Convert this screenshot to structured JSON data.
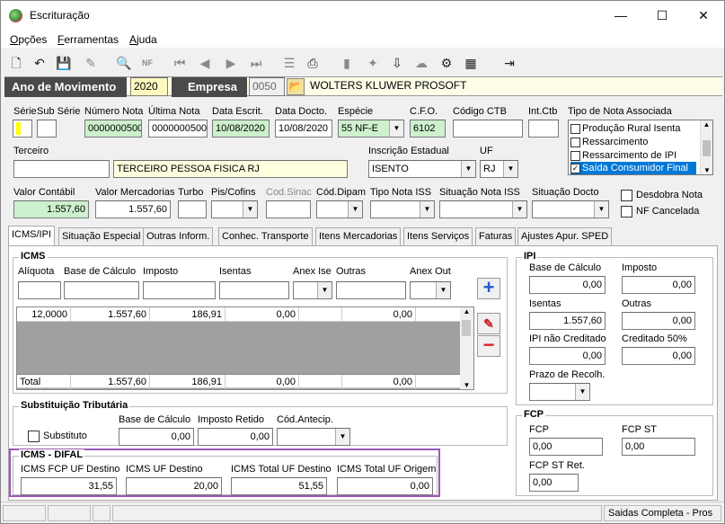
{
  "window": {
    "title": "Escrituração",
    "min": "—",
    "max": "☐",
    "close": "✕"
  },
  "menu": [
    {
      "u": "O",
      "rest": "pções"
    },
    {
      "u": "F",
      "rest": "erramentas"
    },
    {
      "u": "A",
      "rest": "juda"
    }
  ],
  "yearbar": {
    "ano_label": "Ano de Movimento",
    "ano": "2020",
    "empresa_label": "Empresa",
    "empresa_code": "0050",
    "empresa_name": "WOLTERS KLUWER PROSOFT"
  },
  "header": {
    "serie_label": "Série",
    "subserie_label": "Sub Série",
    "numero_nota_label": "Número Nota",
    "numero_nota": "0000000500",
    "ultima_nota_label": "Última Nota",
    "ultima_nota": "0000000500",
    "data_escrit_label": "Data Escrit.",
    "data_escrit": "10/08/2020",
    "data_docto_label": "Data Docto.",
    "data_docto": "10/08/2020",
    "especie_label": "Espécie",
    "especie": "55  NF-E",
    "cfo_label": "C.F.O.",
    "cfo": "6102",
    "codigo_ctb_label": "Código CTB",
    "int_ctb_label": "Int.Ctb",
    "tipo_nota_label": "Tipo de Nota Associada",
    "tipo_nota_items": [
      {
        "label": "Produção Rural Isenta",
        "checked": ""
      },
      {
        "label": "Ressarcimento",
        "checked": ""
      },
      {
        "label": "Ressarcimento de IPI",
        "checked": ""
      },
      {
        "label": "Saída Consumidor Final",
        "checked": "✓"
      }
    ],
    "terceiro_label": "Terceiro",
    "terceiro_name": "TERCEIRO PESSOA FISICA RJ",
    "inscricao_label": "Inscrição Estadual",
    "inscricao": "ISENTO",
    "uf_label": "UF",
    "uf": "RJ",
    "valor_contabil_label": "Valor Contábil",
    "valor_contabil": "1.557,60",
    "valor_merc_label": "Valor Mercadorias",
    "valor_merc": "1.557,60",
    "turbo_label": "Turbo",
    "pis_label": "Pis/Cofins",
    "cod_sinac_label": "Cod.Sinac",
    "cod_dipam_label": "Cód.Dipam",
    "tipo_iss_label": "Tipo Nota ISS",
    "sit_iss_label": "Situação Nota ISS",
    "sit_docto_label": "Situação Docto",
    "desdobra_label": "Desdobra Nota",
    "cancelada_label": "NF Cancelada"
  },
  "tabs": [
    "ICMS/IPI",
    "Situação Especial",
    "Outras Inform.",
    "Conhec. Transporte",
    "Itens Mercadorias",
    "Itens Serviços",
    "Faturas",
    "Ajustes Apur. SPED"
  ],
  "icms": {
    "title": "ICMS",
    "cols": [
      "Alíquota",
      "Base de Cálculo",
      "Imposto",
      "Isentas",
      "Anex Ise",
      "Outras",
      "Anex Out"
    ],
    "row": [
      "12,0000",
      "1.557,60",
      "186,91",
      "0,00",
      "",
      "0,00",
      ""
    ],
    "total_label": "Total",
    "total": [
      "1.557,60",
      "186,91",
      "0,00",
      "0,00"
    ]
  },
  "ipi": {
    "title": "IPI",
    "base_label": "Base de Cálculo",
    "base": "0,00",
    "imposto_label": "Imposto",
    "imposto": "0,00",
    "isentas_label": "Isentas",
    "isentas": "1.557,60",
    "outras_label": "Outras",
    "outras": "0,00",
    "nao_cred_label": "IPI não Creditado",
    "nao_cred": "0,00",
    "cred50_label": "Creditado 50%",
    "cred50": "0,00",
    "prazo_label": "Prazo de Recolh."
  },
  "st": {
    "title": "Substituição Tributária",
    "substituto_label": "Substituto",
    "base_label": "Base de Cálculo",
    "base": "0,00",
    "imposto_label": "Imposto Retido",
    "imposto": "0,00",
    "cod_label": "Cód.Antecip."
  },
  "fcp": {
    "title": "FCP",
    "fcp_label": "FCP",
    "fcp": "0,00",
    "fcp_st_label": "FCP ST",
    "fcp_st": "0,00",
    "fcp_st_ret_label": "FCP ST Ret.",
    "fcp_st_ret": "0,00"
  },
  "difal": {
    "title": "ICMS - DIFAL",
    "fcp_destino_label": "ICMS FCP UF Destino",
    "fcp_destino": "31,55",
    "uf_destino_label": "ICMS UF Destino",
    "uf_destino": "20,00",
    "total_destino_label": "ICMS Total UF Destino",
    "total_destino": "51,55",
    "total_origem_label": "ICMS Total UF Origem",
    "total_origem": "0,00",
    "highlight_color": "#9b59b6"
  },
  "status": {
    "text": "Saidas Completa - Pros"
  }
}
